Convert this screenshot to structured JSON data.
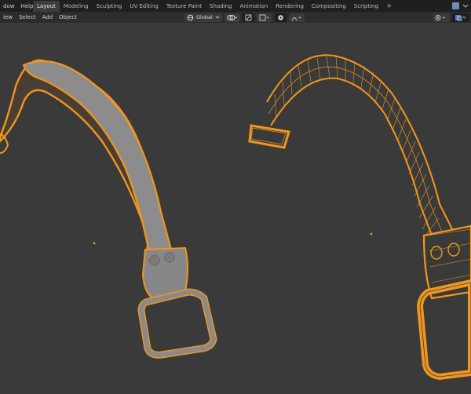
{
  "menu": {
    "window": "dow",
    "help": "Help"
  },
  "tabs": [
    "Layout",
    "Modeling",
    "Sculpting",
    "UV Editing",
    "Texture Paint",
    "Shading",
    "Animation",
    "Rendering",
    "Compositing",
    "Scripting"
  ],
  "tab_add": "+",
  "header_menu": {
    "view": "iew",
    "select": "Select",
    "add": "Add",
    "object": "Object"
  },
  "transform": {
    "orientation": "Global"
  },
  "colors": {
    "selection": "#f0961e",
    "background": "#3a3a3a",
    "mesh": "#8a8a8a"
  },
  "icons": [
    "orientation-icon",
    "pivot-icon",
    "snap-icon",
    "proportional-icon",
    "falloff-icon",
    "overlay-icon",
    "xray-icon",
    "origin-dot-icon"
  ]
}
